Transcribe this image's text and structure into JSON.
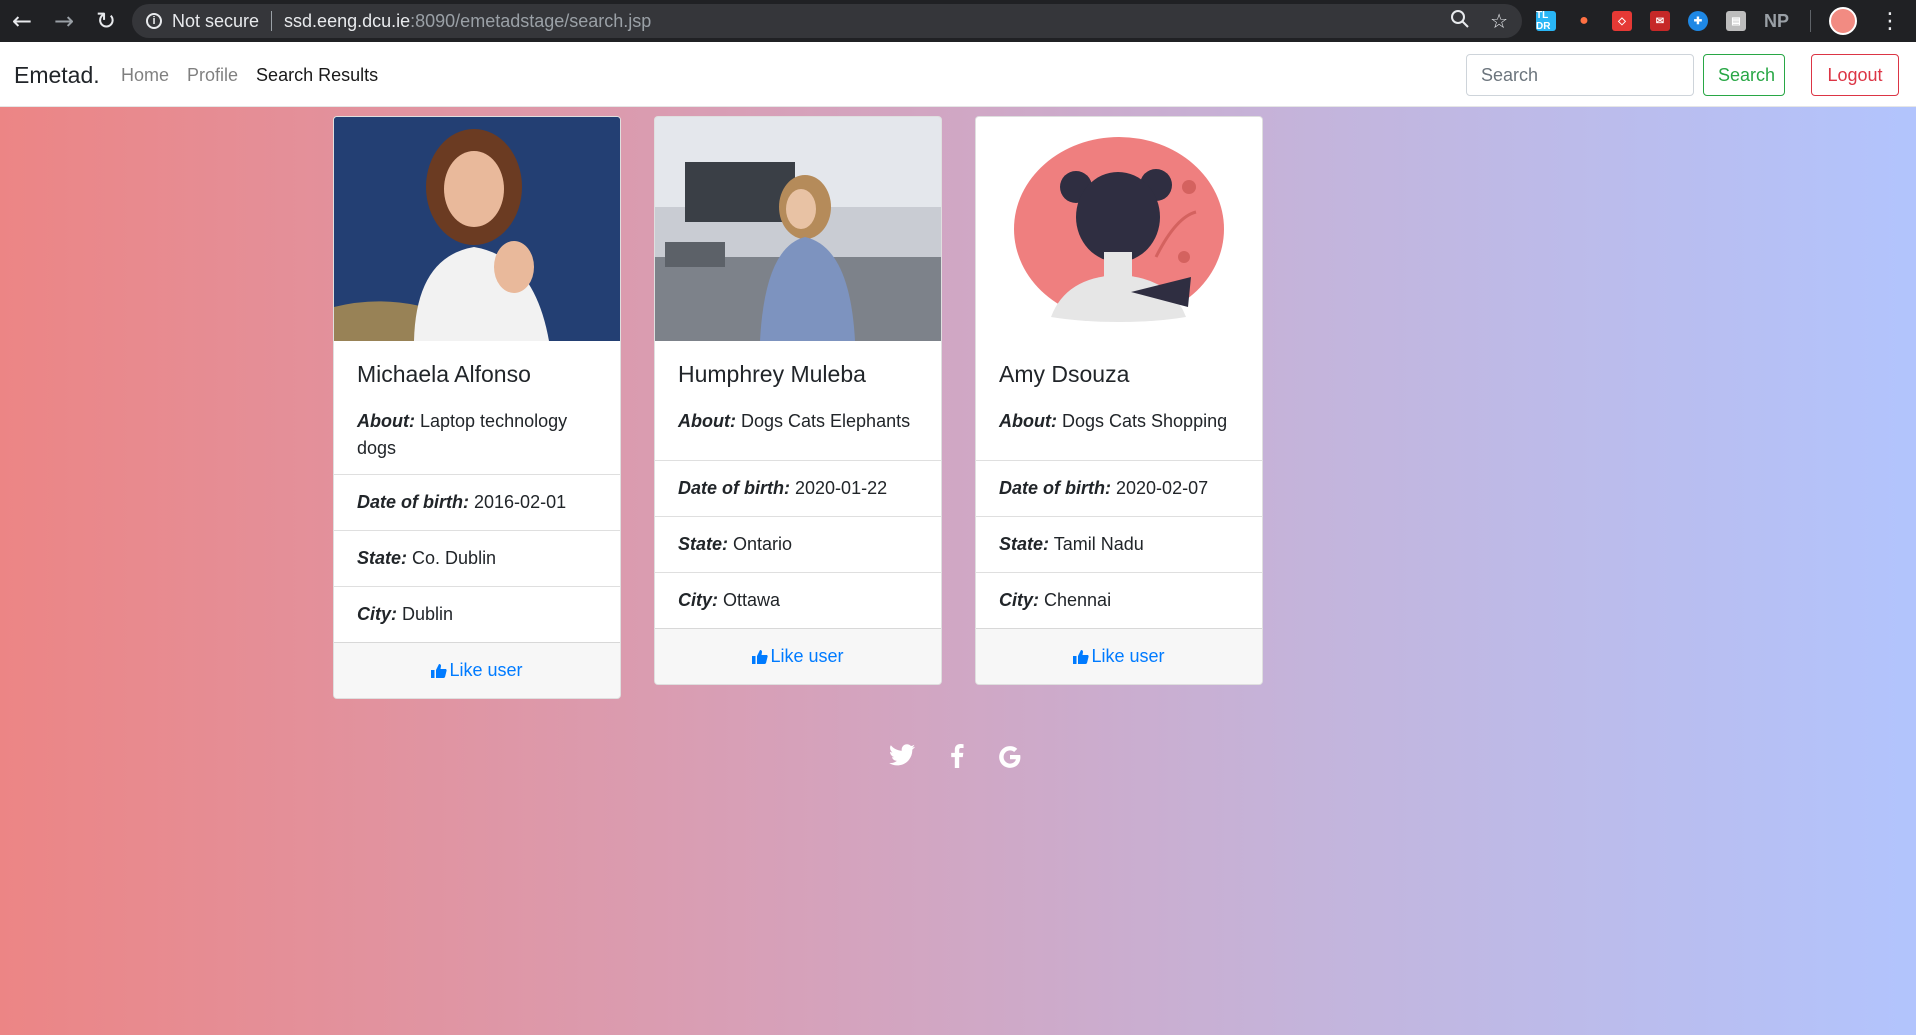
{
  "browser": {
    "not_secure": "Not secure",
    "url_host": "ssd.eeng.dcu.ie",
    "url_rest": ":8090/emetadstage/search.jsp",
    "extensions": [
      "TL DR",
      "NP"
    ]
  },
  "navbar": {
    "brand": "Emetad.",
    "links": [
      "Home",
      "Profile",
      "Search Results"
    ],
    "search_placeholder": "Search",
    "search_button": "Search",
    "logout_button": "Logout"
  },
  "labels": {
    "about": "About:",
    "dob": "Date of birth:",
    "state": "State:",
    "city": "City:",
    "like": "Like user"
  },
  "users": [
    {
      "name": "Michaela Alfonso",
      "about": "Laptop technology dogs",
      "dob": "2016-02-01",
      "state": "Co. Dublin",
      "city": "Dublin"
    },
    {
      "name": "Humphrey Muleba",
      "about": "Dogs Cats Elephants",
      "dob": "2020-01-22",
      "state": "Ontario",
      "city": "Ottawa"
    },
    {
      "name": "Amy Dsouza",
      "about": "Dogs Cats Shopping",
      "dob": "2020-02-07",
      "state": "Tamil Nadu",
      "city": "Chennai"
    }
  ],
  "social": [
    "twitter-icon",
    "facebook-icon",
    "google-icon"
  ],
  "colors": {
    "gradient_start": "#ec8585",
    "gradient_end": "#b2c4fd",
    "link": "#007bff",
    "success": "#28a745",
    "danger": "#dc3545"
  }
}
